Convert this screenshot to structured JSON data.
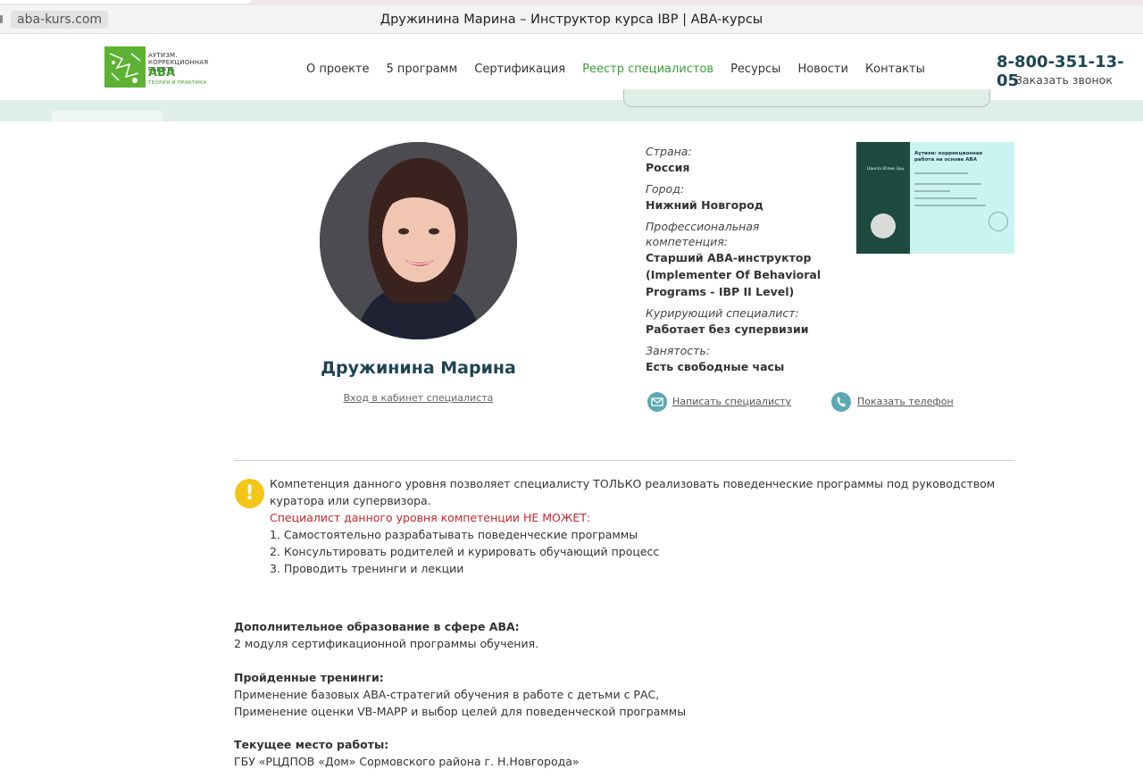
{
  "browser": {
    "url": "aba-kurs.com",
    "title": "Дружинина Марина – Инструктор курса IBP | ABA-курсы"
  },
  "header": {
    "logo": {
      "line1": "АУТИЗМ.",
      "line2": "КОРРЕКЦИОННАЯ",
      "line3": "РАБОТА",
      "brand": "АВА",
      "tagline": "ТЕОРИЯ И ПРАКТИКА"
    },
    "nav": [
      {
        "label": "О проекте"
      },
      {
        "label": "5 программ"
      },
      {
        "label": "Сертификация"
      },
      {
        "label": "Реестр специалистов",
        "active": true
      },
      {
        "label": "Ресурсы"
      },
      {
        "label": "Новости"
      },
      {
        "label": "Контакты"
      }
    ],
    "phone": "8-800-351-13-05",
    "callback": "Заказать звонок"
  },
  "colors": {
    "accent_green": "#3b9d37",
    "name_dark": "#1f4454",
    "warning_yellow": "#f5c518",
    "warning_red": "#c0282d",
    "band": "#dfeee6"
  },
  "profile": {
    "name": "Дружинина Марина",
    "cabinet_link": "Вход в кабинет специалиста",
    "fields": [
      {
        "label": "Страна:",
        "value": "Россия"
      },
      {
        "label": "Город:",
        "value": "Нижний Новгород"
      },
      {
        "label": "Профессиональная компетенция:",
        "value": "Старший АВА-инструктор (Implementer Of Behavioral Programs - IBP II Level)"
      },
      {
        "label": "Курирующий специалист:",
        "value": "Работает без супервизии"
      },
      {
        "label": "Занятость:",
        "value": "Есть свободные часы"
      }
    ],
    "actions": {
      "write": "Написать специалисту",
      "phone": "Показать телефон"
    },
    "certificate": {
      "title": "Аутизм: коррекционная работа на основе АВА",
      "school": "Школа Юлии Эрц"
    }
  },
  "notice": {
    "text": "Компетенция данного уровня позволяет специалисту ТОЛЬКО реализовать поведенческие программы под руководством куратора или супервизора.",
    "restriction": "Специалист данного уровня компетенции НЕ МОЖЕТ:",
    "items": [
      "1. Самостоятельно разрабатывать поведенческие программы",
      "2. Консультировать родителей и курировать обучающий процесс",
      "3. Проводить тренинги и лекции"
    ]
  },
  "sections": {
    "education_title": "Дополнительное образование в сфере АВА:",
    "education_text": "2 модуля сертификационной программы обучения.",
    "trainings_title": "Пройденные тренинги:",
    "trainings": [
      "Применение базовых АВА-стратегий обучения в работе с детьми с РАС,",
      "Применение оценки VB-MAPP и выбор целей для поведенческой программы"
    ],
    "work_title": "Текущее место работы:",
    "work_text": "ГБУ «РЦДПОВ «Дом» Сормовского района г. Н.Новгорода»"
  }
}
